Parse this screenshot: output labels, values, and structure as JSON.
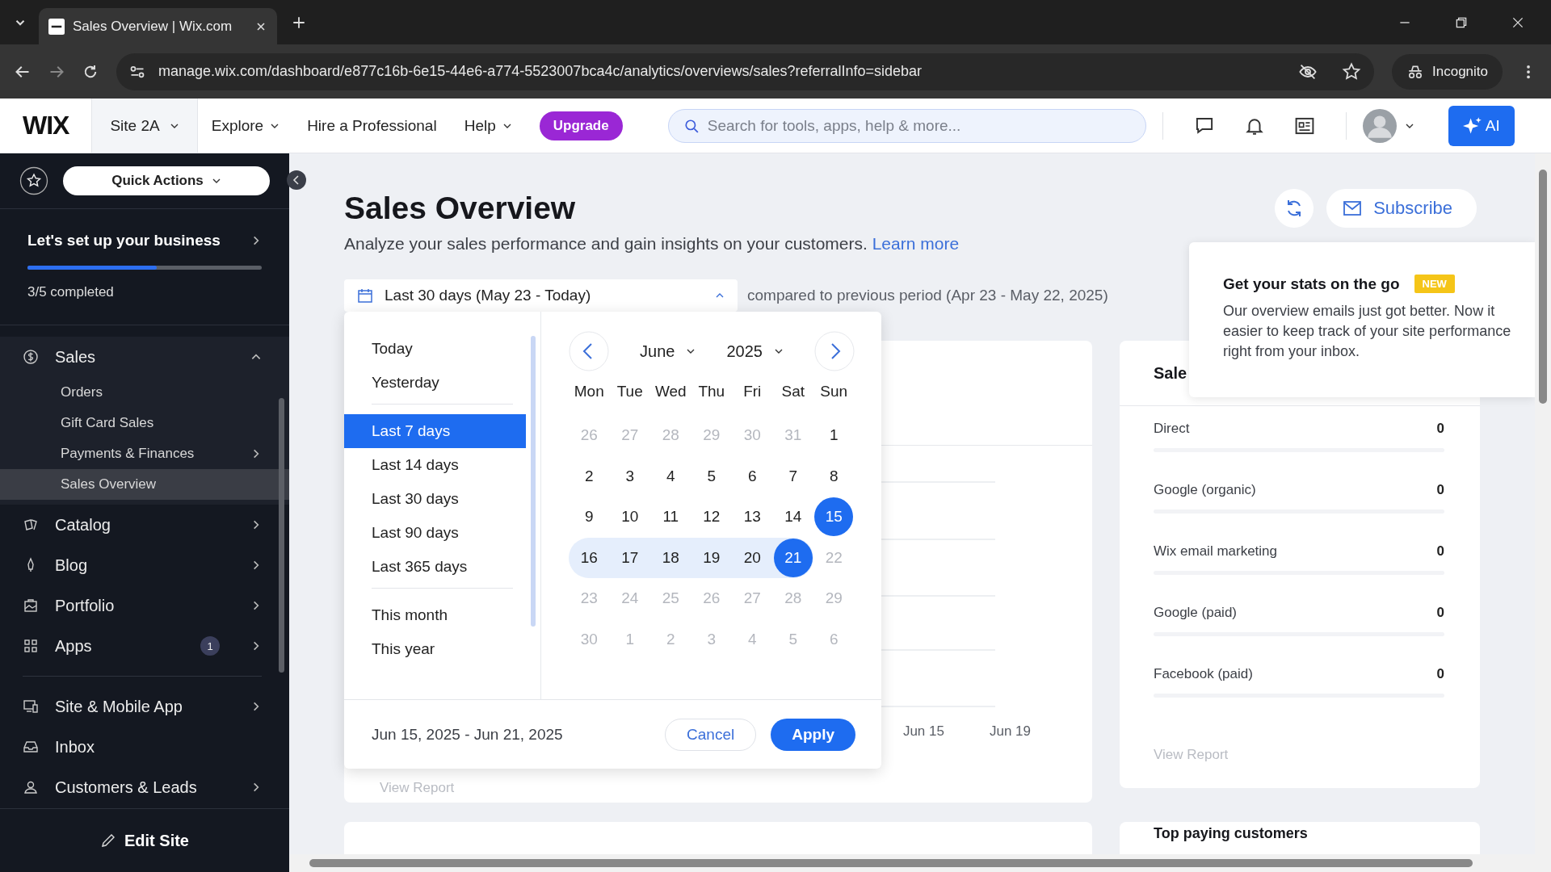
{
  "browser": {
    "tab_title": "Sales Overview | Wix.com",
    "url": "manage.wix.com/dashboard/e877c16b-6e15-44e6-a774-5523007bca4c/analytics/overviews/sales?referralInfo=sidebar",
    "profile": "Incognito"
  },
  "header": {
    "logo": "WIX",
    "site": "Site 2A",
    "menu": [
      {
        "label": "Explore",
        "dropdown": true
      },
      {
        "label": "Hire a Professional",
        "dropdown": false
      },
      {
        "label": "Help",
        "dropdown": true
      }
    ],
    "upgrade": "Upgrade",
    "search": {
      "placeholder": "Search for tools, apps, help & more..."
    },
    "ai_button": "AI"
  },
  "sidebar": {
    "quick_actions": "Quick Actions",
    "setup": {
      "title": "Let's set up your business",
      "level": 0.55,
      "progress": "3/5 completed"
    },
    "groups": [
      [
        {
          "label": "Sales",
          "selected": false,
          "expanded": true,
          "children": [
            {
              "label": "Orders",
              "selected": false,
              "submenu": false
            },
            {
              "label": "Gift Card Sales",
              "selected": false,
              "submenu": false
            },
            {
              "label": "Payments & Finances",
              "selected": false,
              "submenu": true
            },
            {
              "label": "Sales Overview",
              "selected": true,
              "submenu": false
            }
          ]
        },
        {
          "label": "Catalog",
          "selected": false,
          "submenu": true
        },
        {
          "label": "Blog",
          "selected": false,
          "submenu": true
        },
        {
          "label": "Portfolio",
          "selected": false,
          "submenu": true
        },
        {
          "label": "Apps",
          "selected": false,
          "submenu": true,
          "badge": "1"
        }
      ],
      [
        {
          "label": "Site & Mobile App",
          "selected": false,
          "submenu": true
        },
        {
          "label": "Inbox",
          "selected": false,
          "submenu": false
        },
        {
          "label": "Customers & Leads",
          "selected": false,
          "submenu": true
        }
      ]
    ],
    "edit_site": "Edit Site"
  },
  "page": {
    "title": "Sales Overview",
    "subtitle": "Analyze your sales performance and gain insights on your customers.",
    "learn_more": "Learn more",
    "subscribe": "Subscribe",
    "date_range": "Last 30 days (May 23 - Today)",
    "comparison": "compared to previous period (Apr 23 - May 22, 2025)"
  },
  "date_picker": {
    "preset_groups": [
      [
        {
          "label": "Today",
          "selected": false
        },
        {
          "label": "Yesterday",
          "selected": false
        }
      ],
      [
        {
          "label": "Last 7 days",
          "selected": true
        },
        {
          "label": "Last 14 days",
          "selected": false
        },
        {
          "label": "Last 30 days",
          "selected": false
        },
        {
          "label": "Last 90 days",
          "selected": false
        },
        {
          "label": "Last 365 days",
          "selected": false
        }
      ],
      [
        {
          "label": "This month",
          "selected": false
        },
        {
          "label": "This year",
          "selected": false
        }
      ]
    ],
    "month": "June",
    "year": "2025",
    "weekdays": [
      "Mon",
      "Tue",
      "Wed",
      "Thu",
      "Fri",
      "Sat",
      "Sun"
    ],
    "weeks": [
      [
        {
          "label": "26",
          "muted": true,
          "selected": false,
          "in_range": false
        },
        {
          "label": "27",
          "muted": true,
          "selected": false,
          "in_range": false
        },
        {
          "label": "28",
          "muted": true,
          "selected": false,
          "in_range": false
        },
        {
          "label": "29",
          "muted": true,
          "selected": false,
          "in_range": false
        },
        {
          "label": "30",
          "muted": true,
          "selected": false,
          "in_range": false
        },
        {
          "label": "31",
          "muted": true,
          "selected": false,
          "in_range": false
        },
        {
          "label": "1",
          "muted": false,
          "selected": false,
          "in_range": false
        }
      ],
      [
        {
          "label": "2",
          "muted": false,
          "selected": false,
          "in_range": false
        },
        {
          "label": "3",
          "muted": false,
          "selected": false,
          "in_range": false
        },
        {
          "label": "4",
          "muted": false,
          "selected": false,
          "in_range": false
        },
        {
          "label": "5",
          "muted": false,
          "selected": false,
          "in_range": false
        },
        {
          "label": "6",
          "muted": false,
          "selected": false,
          "in_range": false
        },
        {
          "label": "7",
          "muted": false,
          "selected": false,
          "in_range": false
        },
        {
          "label": "8",
          "muted": false,
          "selected": false,
          "in_range": false
        }
      ],
      [
        {
          "label": "9",
          "muted": false,
          "selected": false,
          "in_range": false
        },
        {
          "label": "10",
          "muted": false,
          "selected": false,
          "in_range": false
        },
        {
          "label": "11",
          "muted": false,
          "selected": false,
          "in_range": false
        },
        {
          "label": "12",
          "muted": false,
          "selected": false,
          "in_range": false
        },
        {
          "label": "13",
          "muted": false,
          "selected": false,
          "in_range": false
        },
        {
          "label": "14",
          "muted": false,
          "selected": false,
          "in_range": false
        },
        {
          "label": "15",
          "muted": false,
          "selected": true,
          "in_range": false
        }
      ],
      [
        {
          "label": "16",
          "muted": false,
          "selected": false,
          "in_range": true
        },
        {
          "label": "17",
          "muted": false,
          "selected": false,
          "in_range": true
        },
        {
          "label": "18",
          "muted": false,
          "selected": false,
          "in_range": true
        },
        {
          "label": "19",
          "muted": false,
          "selected": false,
          "in_range": true
        },
        {
          "label": "20",
          "muted": false,
          "selected": false,
          "in_range": true
        },
        {
          "label": "21",
          "muted": false,
          "selected": true,
          "in_range": true
        },
        {
          "label": "22",
          "muted": true,
          "selected": false,
          "in_range": false
        }
      ],
      [
        {
          "label": "23",
          "muted": true,
          "selected": false,
          "in_range": false
        },
        {
          "label": "24",
          "muted": true,
          "selected": false,
          "in_range": false
        },
        {
          "label": "25",
          "muted": true,
          "selected": false,
          "in_range": false
        },
        {
          "label": "26",
          "muted": true,
          "selected": false,
          "in_range": false
        },
        {
          "label": "27",
          "muted": true,
          "selected": false,
          "in_range": false
        },
        {
          "label": "28",
          "muted": true,
          "selected": false,
          "in_range": false
        },
        {
          "label": "29",
          "muted": true,
          "selected": false,
          "in_range": false
        }
      ],
      [
        {
          "label": "30",
          "muted": true,
          "selected": false,
          "in_range": false
        },
        {
          "label": "1",
          "muted": true,
          "selected": false,
          "in_range": false
        },
        {
          "label": "2",
          "muted": true,
          "selected": false,
          "in_range": false
        },
        {
          "label": "3",
          "muted": true,
          "selected": false,
          "in_range": false
        },
        {
          "label": "4",
          "muted": true,
          "selected": false,
          "in_range": false
        },
        {
          "label": "5",
          "muted": true,
          "selected": false,
          "in_range": false
        },
        {
          "label": "6",
          "muted": true,
          "selected": false,
          "in_range": false
        }
      ]
    ],
    "range_label": "Jun 15, 2025 - Jun 21, 2025",
    "cancel": "Cancel",
    "apply": "Apply"
  },
  "chart_card": {
    "x_labels": [
      "Jun 15",
      "Jun 19"
    ],
    "view_report": "View Report"
  },
  "traffic_card": {
    "title": "Sale",
    "rows": [
      {
        "label": "Direct",
        "value": "0"
      },
      {
        "label": "Google (organic)",
        "value": "0"
      },
      {
        "label": "Wix email marketing",
        "value": "0"
      },
      {
        "label": "Google (paid)",
        "value": "0"
      },
      {
        "label": "Facebook (paid)",
        "value": "0"
      }
    ],
    "view_report": "View Report"
  },
  "tooltip": {
    "title": "Get your stats on the go",
    "badge": "NEW",
    "text": "Our overview emails just got better. Now it easier to keep track of your site performance right from your inbox."
  },
  "bottom_card": {
    "title": "Top paying customers"
  }
}
